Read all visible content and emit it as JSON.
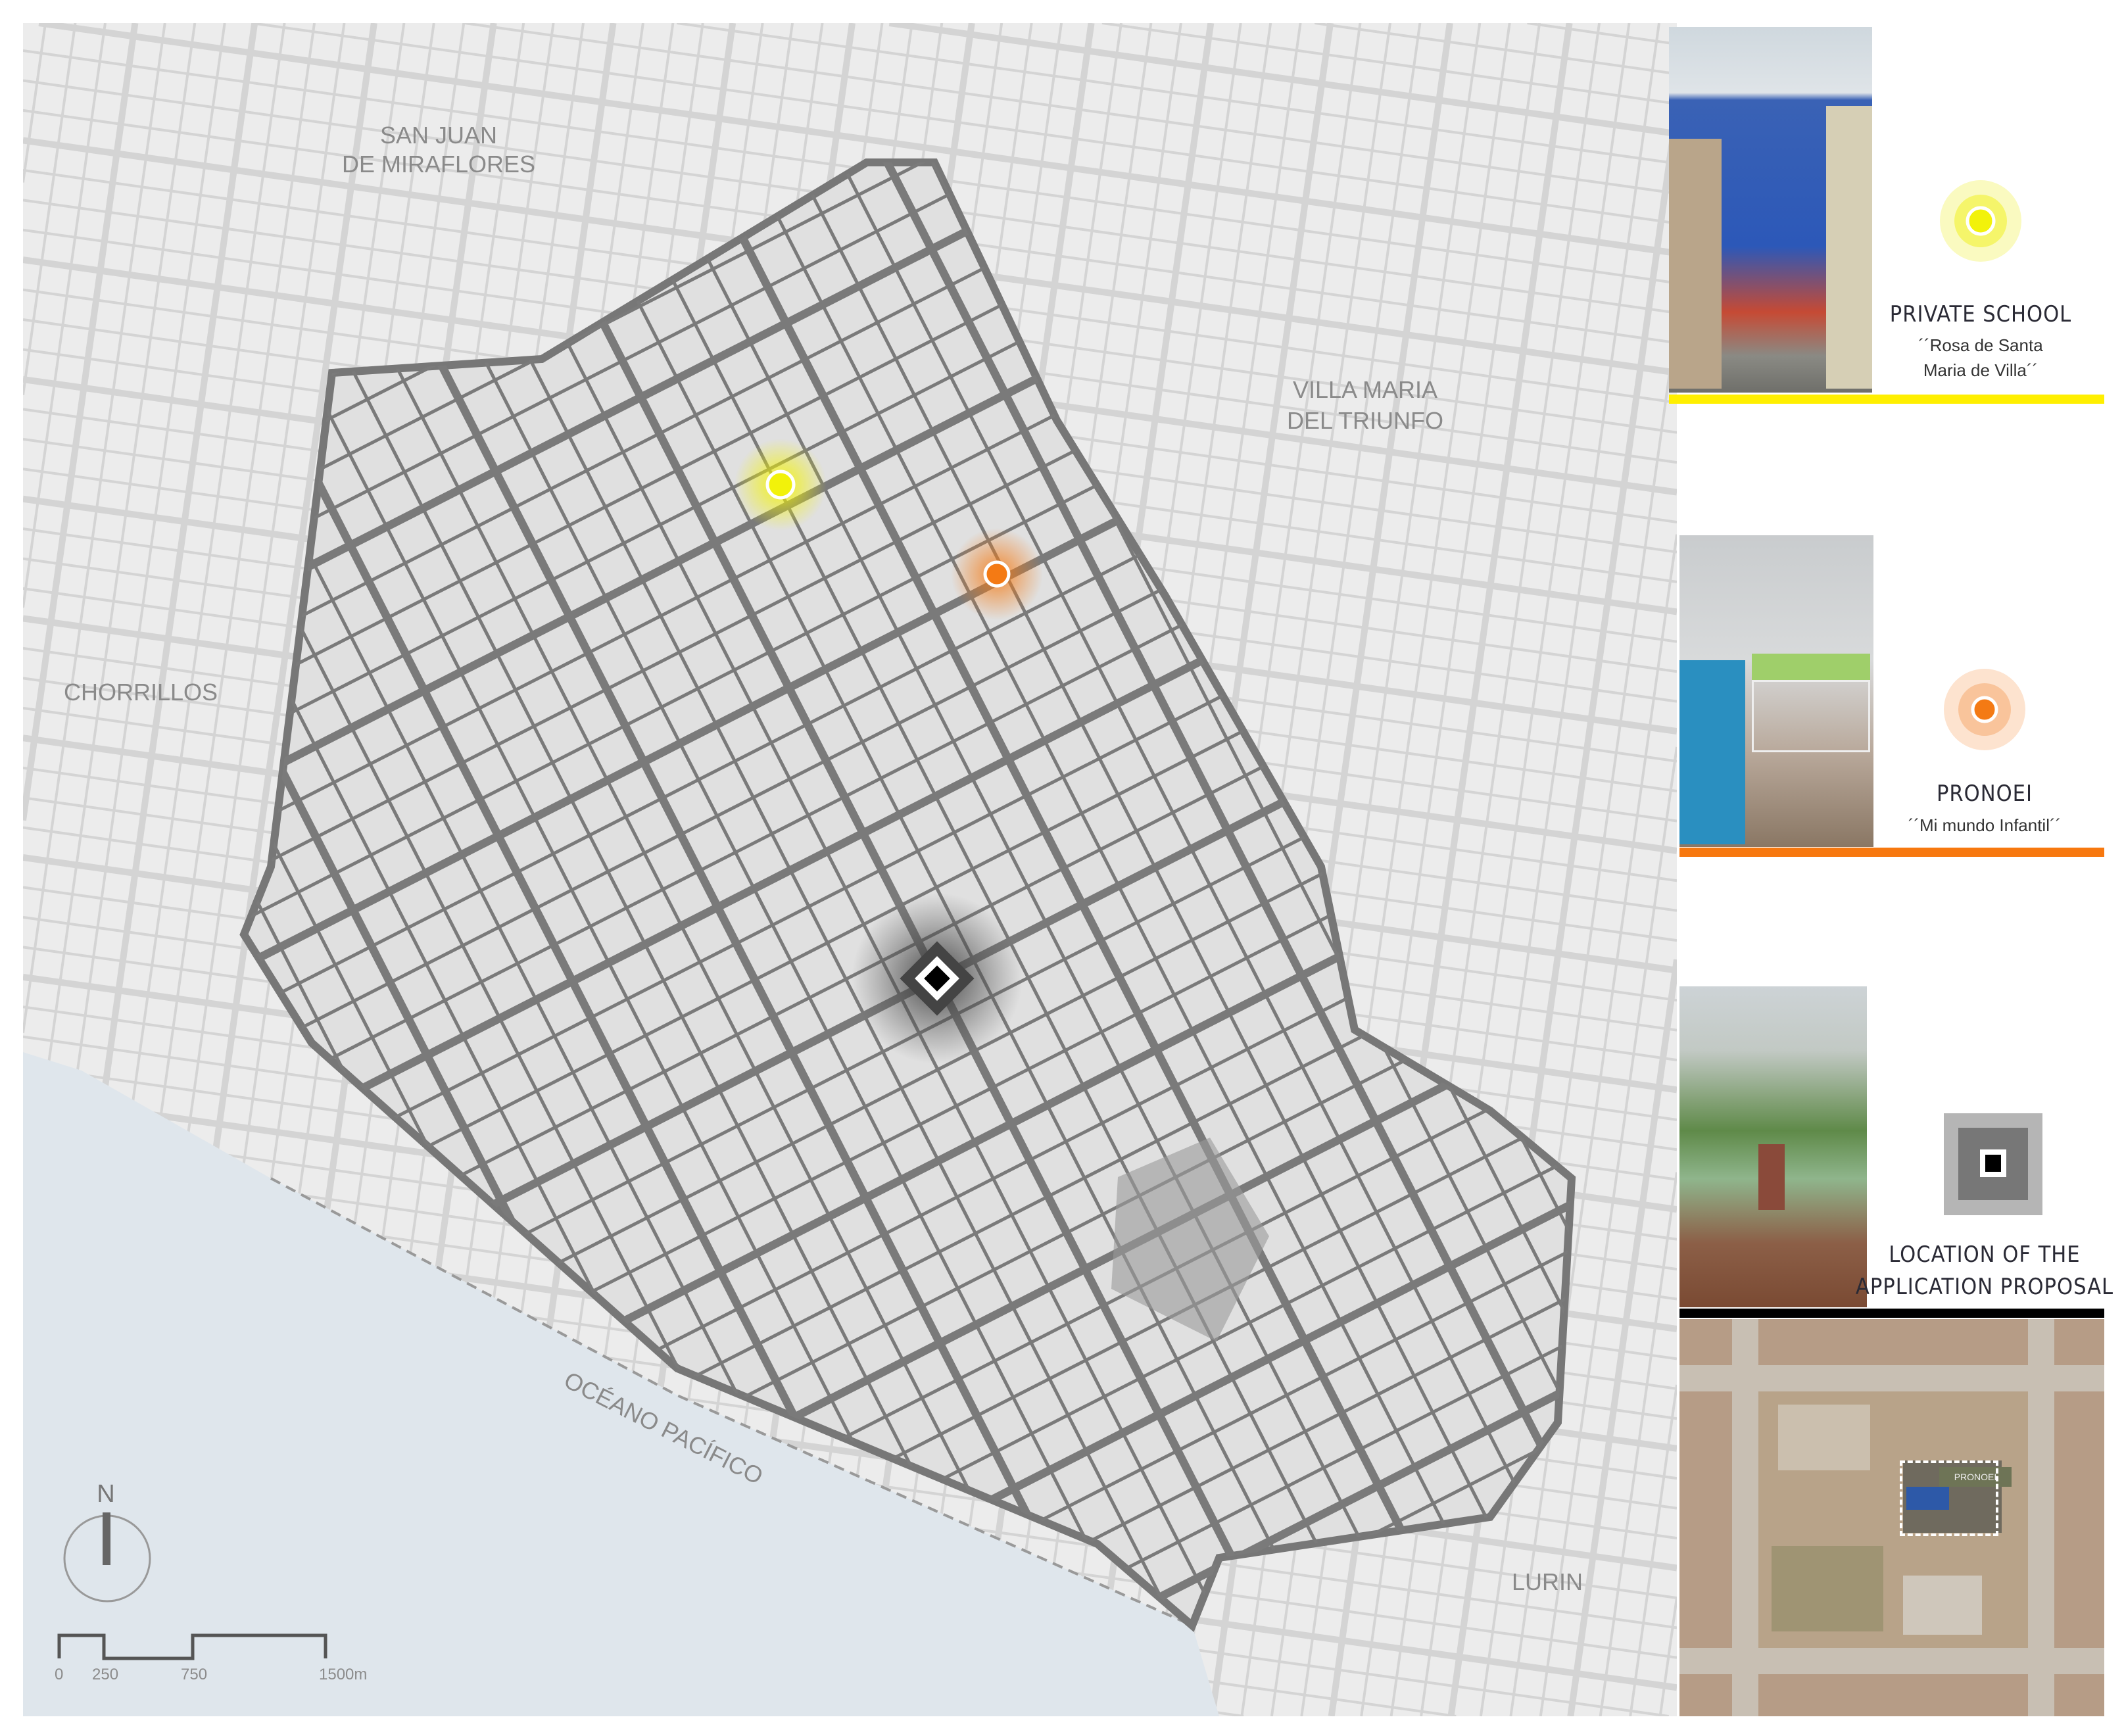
{
  "map": {
    "labels": {
      "san_juan_1": "SAN JUAN",
      "san_juan_2": "DE MIRAFLORES",
      "villa_maria_1": "VILLA MARIA",
      "villa_maria_2": "DEL TRIUNFO",
      "chorrillos": "CHORRILLOS",
      "ocean": "OCÉANO PACÍFICO",
      "lurin": "LURIN"
    },
    "north": "N",
    "scale": [
      "0",
      "250",
      "750",
      "1500m"
    ],
    "colors": {
      "ocean": "#dfe6ec",
      "land": "#ececec",
      "district": "#e2e2e2",
      "roads": "#6e6e6e",
      "yellow": "#f2f20a",
      "orange": "#f47a14"
    }
  },
  "legend": {
    "private_school": {
      "title": "PRIVATE SCHOOL",
      "line1": "´´Rosa de Santa",
      "line2": "Maria de Villa´´",
      "color": "#ffef00"
    },
    "pronoei": {
      "title": "PRONOEI",
      "line1": "´´Mi mundo Infantil´´",
      "color": "#f7780f"
    },
    "proposal": {
      "line1": "LOCATION OF THE",
      "line2": "APPLICATION PROPOSAL",
      "color": "#000000"
    },
    "satellite_label": "PRONOEI"
  }
}
